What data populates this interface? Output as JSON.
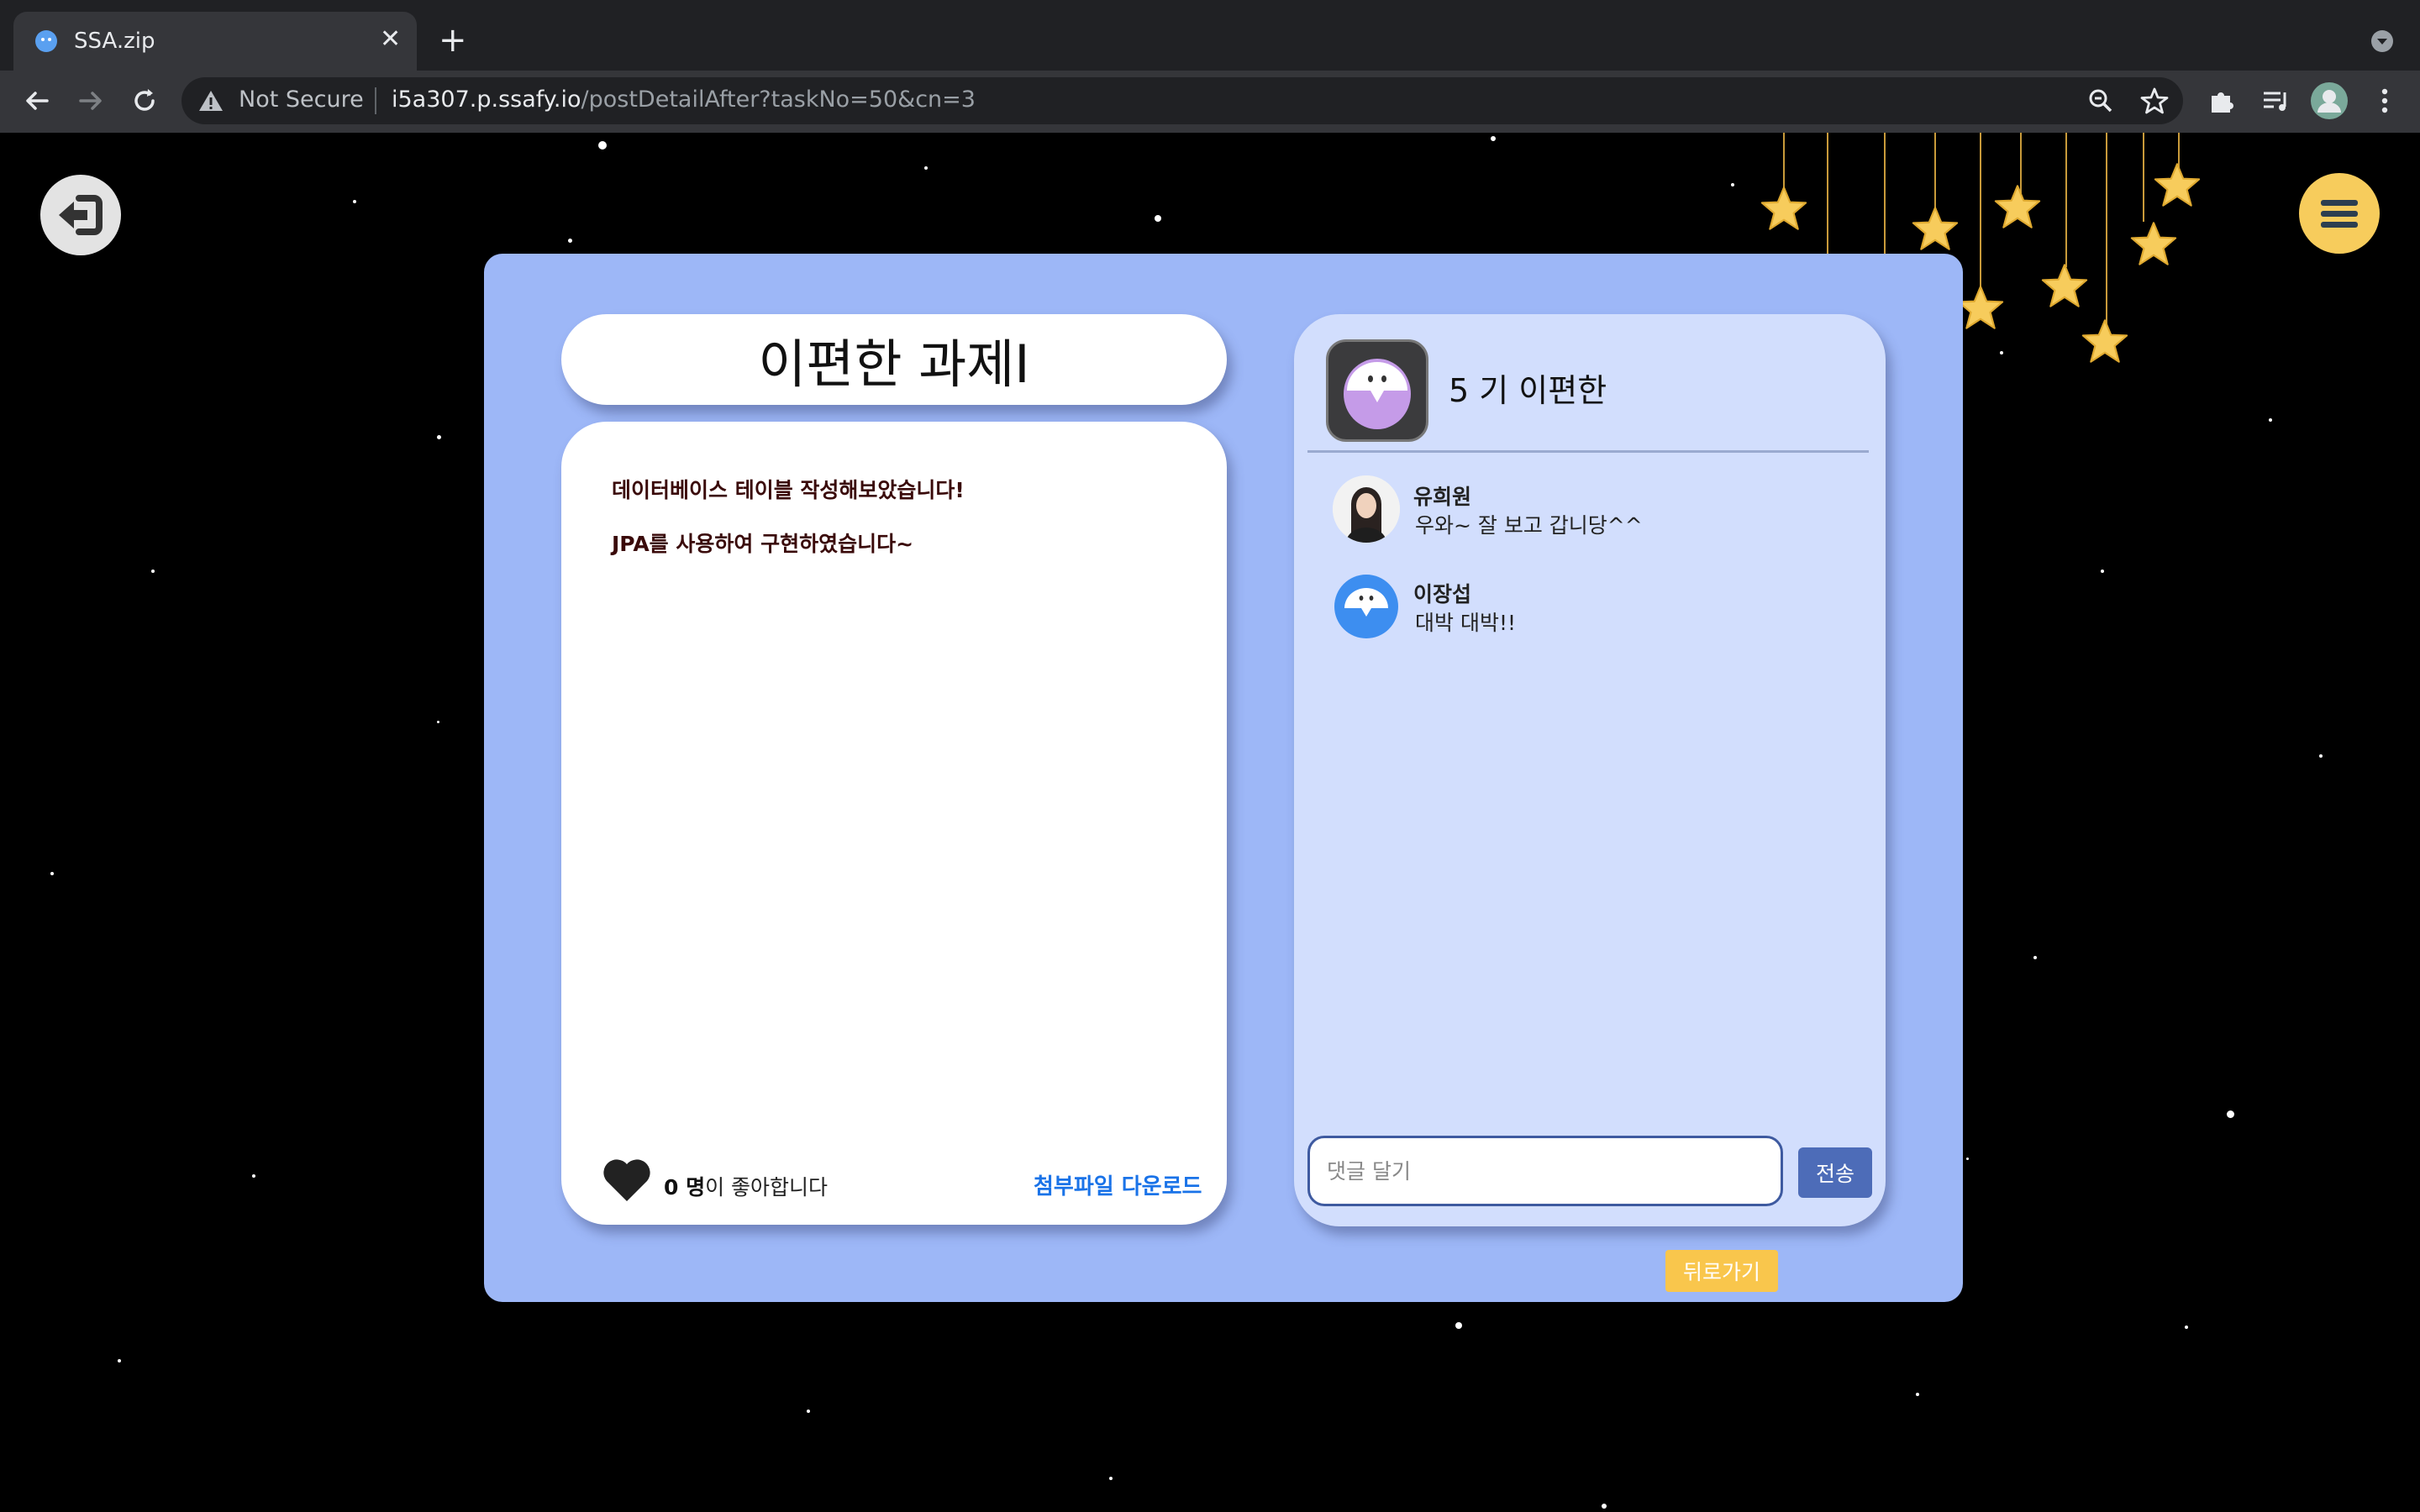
{
  "browser": {
    "tab_title": "SSA.zip",
    "security_label": "Not Secure",
    "url_host": "i5a307.p.ssafy.io",
    "url_path": "/postDetailAfter?taskNo=50&cn=3"
  },
  "post": {
    "title": "이편한 과제I",
    "content_lines": [
      "데이터베이스 테이블 작성해보았습니다!",
      "JPA를 사용하여 구현하였습니다~"
    ],
    "like_count": "0 명",
    "like_suffix": "이 좋아합니다",
    "download_label": "첨부파일 다운로드"
  },
  "author": {
    "name": "5 기 이편한"
  },
  "comments": [
    {
      "name": "유희원",
      "text": "우와~ 잘 보고 갑니당^^"
    },
    {
      "name": "이장섭",
      "text": "대박 대박!!"
    }
  ],
  "comment_form": {
    "placeholder": "댓글 달기",
    "send_label": "전송"
  },
  "back_label": "뒤로가기",
  "colors": {
    "panel": "#9db7f7",
    "comment_panel": "#d2defd",
    "accent_yellow": "#f9c64c",
    "send_button": "#4d6cb8",
    "link_blue": "#1a73e8"
  },
  "icons": [
    "tab-favicon-icon",
    "close-icon",
    "plus-icon",
    "back-arrow-icon",
    "forward-arrow-icon",
    "reload-icon",
    "warning-icon",
    "zoom-icon",
    "bookmark-star-icon",
    "extensions-icon",
    "media-icon",
    "profile-icon",
    "kebab-menu-icon",
    "logout-icon",
    "hamburger-menu-icon",
    "heart-icon"
  ]
}
